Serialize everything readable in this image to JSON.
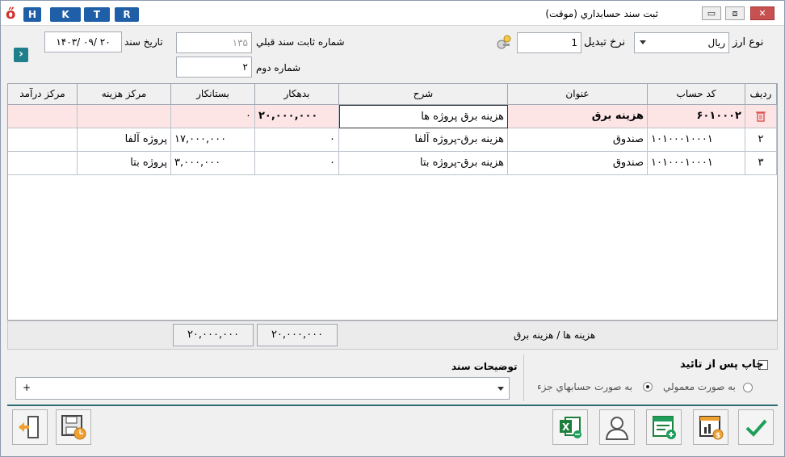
{
  "title_bar": {
    "title": "ثبت سند حسابداري (موقت)",
    "hotkeys": [
      "H",
      "K",
      "T",
      "R"
    ],
    "minimize_glyph": "▭",
    "restore_glyph": "⧈",
    "close_glyph": "✕",
    "logo_glyph": "ő"
  },
  "header": {
    "currency_label": "نوع ارز",
    "currency_value": "ريال",
    "rate_label": "نرخ تبديل",
    "rate_value": "1",
    "fixed_no_label": "شماره ثابت سند قبلي",
    "fixed_no_value": "۱۳۵",
    "second_no_label": "شماره دوم",
    "second_no_value": "۲",
    "doc_date_label": "تاريخ سند",
    "doc_date_value": "۱۴۰۳/ ۰۹/ ۲۰",
    "nav_glyph": "›"
  },
  "table": {
    "columns": [
      "رديف",
      "كد حساب",
      "عنوان",
      "شرح",
      "بدهكار",
      "بستانكار",
      "مركز هزينه",
      "مركز درآمد"
    ],
    "rows": [
      {
        "row": "",
        "account": "۶۰۱۰۰۰۲",
        "title": "هزينه برق",
        "desc": "هزينه برق پروژه ها",
        "debit": "۲۰,۰۰۰,۰۰۰",
        "credit": "۰",
        "cost_center": "",
        "income_center": ""
      },
      {
        "row": "۲",
        "account": "۱۰۱۰۰۰۱۰۰۰۱",
        "title": "صندوق",
        "desc": "هزينه برق-پروژه آلفا",
        "debit": "۰",
        "credit": "۱۷,۰۰۰,۰۰۰",
        "cost_center": "پروژه آلفا",
        "income_center": ""
      },
      {
        "row": "۳",
        "account": "۱۰۱۰۰۰۱۰۰۰۱",
        "title": "صندوق",
        "desc": "هزينه برق-پروژه بتا",
        "debit": "۰",
        "credit": "۳,۰۰۰,۰۰۰",
        "cost_center": "پروژه بتا",
        "income_center": ""
      }
    ]
  },
  "summary": {
    "account_path": "هزينه ها / هزينه برق",
    "debit_total": "۲۰,۰۰۰,۰۰۰",
    "credit_total": "۲۰,۰۰۰,۰۰۰"
  },
  "footer": {
    "print_after_confirm": "چاپ پس از تائيد",
    "normal_mode": "به صورت معمولي",
    "detail_mode": "به صورت حسابهاي جزء",
    "doc_desc_label": "توضيحات سند",
    "doc_desc_value": "+"
  },
  "colors": {
    "accent_blue": "#1f5fa8",
    "selected_row": "#fde5e6",
    "confirm_green": "#1e9e5a",
    "teal": "#2c6c72"
  }
}
